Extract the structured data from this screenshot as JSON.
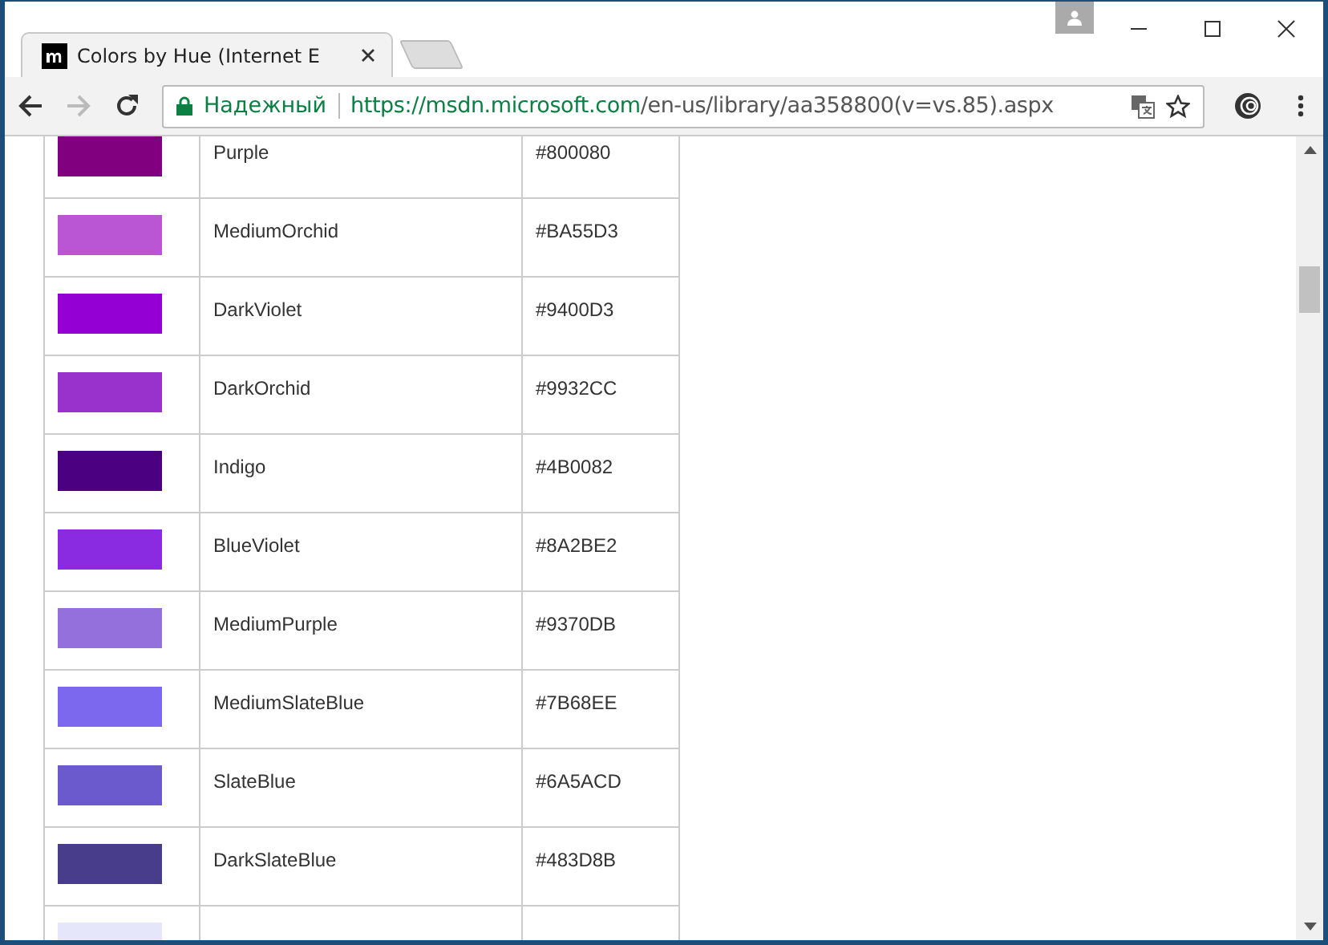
{
  "window": {
    "tab_title": "Colors by Hue (Internet E"
  },
  "address_bar": {
    "security_label": "Надежный",
    "url_host": "https://msdn.microsoft.com",
    "url_path": "/en-us/library/aa358800(v=vs.85).aspx"
  },
  "table": {
    "rows": [
      {
        "name": "Purple",
        "hex": "#800080",
        "color": "#800080"
      },
      {
        "name": "MediumOrchid",
        "hex": "#BA55D3",
        "color": "#ba55d3"
      },
      {
        "name": "DarkViolet",
        "hex": "#9400D3",
        "color": "#9400d3"
      },
      {
        "name": "DarkOrchid",
        "hex": "#9932CC",
        "color": "#9932cc"
      },
      {
        "name": "Indigo",
        "hex": "#4B0082",
        "color": "#4b0082"
      },
      {
        "name": "BlueViolet",
        "hex": "#8A2BE2",
        "color": "#8a2be2"
      },
      {
        "name": "MediumPurple",
        "hex": "#9370DB",
        "color": "#9370db"
      },
      {
        "name": "MediumSlateBlue",
        "hex": "#7B68EE",
        "color": "#7b68ee"
      },
      {
        "name": "SlateBlue",
        "hex": "#6A5ACD",
        "color": "#6a5acd"
      },
      {
        "name": "DarkSlateBlue",
        "hex": "#483D8B",
        "color": "#483d8b"
      },
      {
        "color": "#e6e6fa"
      }
    ]
  }
}
